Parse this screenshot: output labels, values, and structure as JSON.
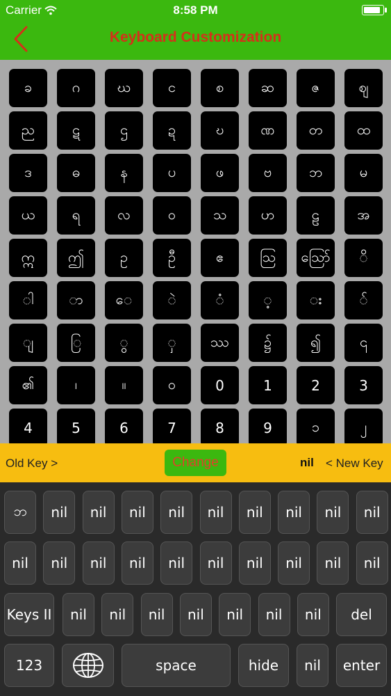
{
  "status": {
    "carrier": "Carrier",
    "time": "8:58 PM",
    "battery_level": 1.0
  },
  "nav": {
    "title": "Keyboard Customization",
    "back_icon": "chevron-left-icon"
  },
  "colors": {
    "accent_green": "#3bb80f",
    "title_red": "#d5301a",
    "bar_yellow": "#f7bd10",
    "grid_bg": "#a9a9a9"
  },
  "grid": {
    "keys": [
      "ခ",
      "ဂ",
      "ဃ",
      "င",
      "စ",
      "ဆ",
      "ဇ",
      "ဈ",
      "ည",
      "ဋ",
      "ဌ",
      "ဍ",
      "ဎ",
      "ဏ",
      "တ",
      "ထ",
      "ဒ",
      "ဓ",
      "န",
      "ပ",
      "ဖ",
      "ဗ",
      "ဘ",
      "မ",
      "ယ",
      "ရ",
      "လ",
      "ဝ",
      "သ",
      "ဟ",
      "ဠ",
      "အ",
      "ဣ",
      "ဤ",
      "ဥ",
      "ဦ",
      "ဧ",
      "ဩ",
      "ဪ",
      "ိ",
      "ါ",
      "ာ",
      "ေ",
      "ဲ",
      "ံ",
      "့",
      "း",
      "်",
      "ျ",
      "ြ",
      "ွ",
      "ှ",
      "ဿ",
      "၌",
      "၍",
      "၎",
      "၏",
      "၊",
      "။",
      "၀",
      "0",
      "1",
      "2",
      "3",
      "4",
      "5",
      "6",
      "7",
      "8",
      "9",
      "၁",
      "၂"
    ]
  },
  "change_bar": {
    "old_key_label": "Old Key >",
    "change_label": "Change",
    "new_key_value": "nil",
    "new_key_label": "< New Key"
  },
  "keyboard": {
    "row1": [
      "ဘ",
      "nil",
      "nil",
      "nil",
      "nil",
      "nil",
      "nil",
      "nil",
      "nil",
      "nil"
    ],
    "row2": [
      "nil",
      "nil",
      "nil",
      "nil",
      "nil",
      "nil",
      "nil",
      "nil",
      "nil",
      "nil"
    ],
    "row3": [
      "Keys II",
      "nil",
      "nil",
      "nil",
      "nil",
      "nil",
      "nil",
      "nil",
      "del"
    ],
    "row4": {
      "numbers": "123",
      "globe_icon": "globe-icon",
      "space": "space",
      "hide": "hide",
      "nil": "nil",
      "enter": "enter"
    }
  }
}
